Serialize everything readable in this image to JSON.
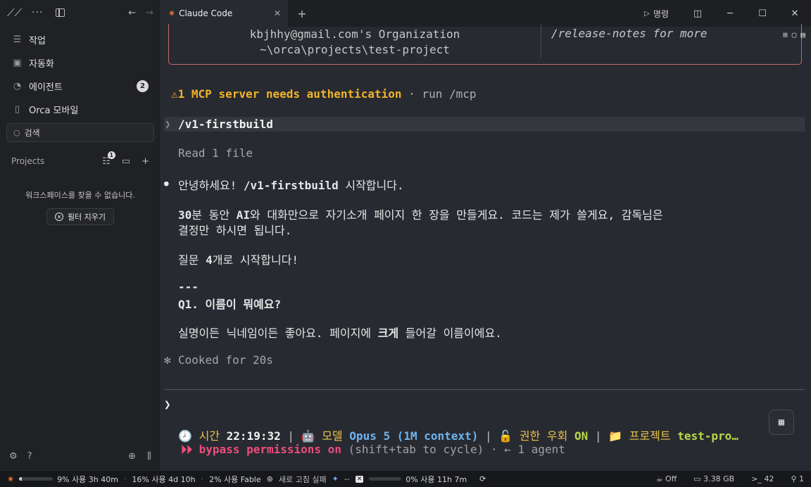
{
  "sidebar": {
    "nav": [
      {
        "label": "작업",
        "icon": "list-icon"
      },
      {
        "label": "자동화",
        "icon": "calendar-icon"
      },
      {
        "label": "에이전트",
        "icon": "bell-icon",
        "badge": "2"
      },
      {
        "label": "Orca 모바일",
        "icon": "phone-icon"
      }
    ],
    "search_placeholder": "검색",
    "projects_label": "Projects",
    "filter_badge": "1",
    "empty_message": "워크스페이스를 찾을 수 없습니다.",
    "clear_filter_label": "필터 지우기"
  },
  "tab": {
    "title": "Claude Code",
    "run_label": "명령"
  },
  "terminal": {
    "org_line1": "kbjhhy@gmail.com's Organization",
    "org_line2": "~\\orca\\projects\\test-project",
    "release_notes": "/release-notes for more",
    "mcp_warning": "1 MCP server needs authentication",
    "mcp_rest": " · run /mcp",
    "command": "/v1-firstbuild",
    "read_files": "Read 1 file",
    "greeting_pre": "안녕하세요! ",
    "greeting_cmd": "/v1-firstbuild",
    "greeting_post": " 시작합니다.",
    "para1_b1": "30",
    "para1_t1": "분 동안 ",
    "para1_b2": "AI",
    "para1_t2": "와 대화만으로 자기소개 페이지 한 장을 만들게요. 코드는 제가 쓸게요, 감독님은",
    "para1_line2": "결정만 하시면 됩니다.",
    "para2_pre": "질문 ",
    "para2_b": "4",
    "para2_post": "개로 시작합니다!",
    "hr": "---",
    "q1": "Q1. 이름이 뭐예요?",
    "q1_desc_pre": "실명이든 닉네임이든 좋아요. 페이지에 ",
    "q1_desc_b": "크게",
    "q1_desc_post": " 들어갈 이름이에요.",
    "cooked": "Cooked for 20s",
    "prompt": "❯",
    "status": {
      "time_label": "시간",
      "time_value": "22:19:32",
      "model_label": "모델",
      "model_value": "Opus 5 (1M context)",
      "perm_label": "권한 우회",
      "perm_value": "ON",
      "project_label": "프로젝트",
      "project_value": "test-pro…"
    },
    "bypass_main": "bypass permissions on",
    "bypass_rest": " (shift+tab to cycle) · ← 1 agent"
  },
  "bottombar": {
    "usage1": "9% 사용 3h 40m",
    "usage1_fill": 0.09,
    "usage2": "16% 사용 4d 10h",
    "usage3": "2% 사용 Fable",
    "refresh": "새로 고침 실패",
    "gemini": "--",
    "usage4": "0% 사용 11h 7m",
    "usage4_fill": 0.0,
    "power": "Off",
    "memory": "3.38 GB",
    "terminals": "42",
    "ports": "1"
  }
}
